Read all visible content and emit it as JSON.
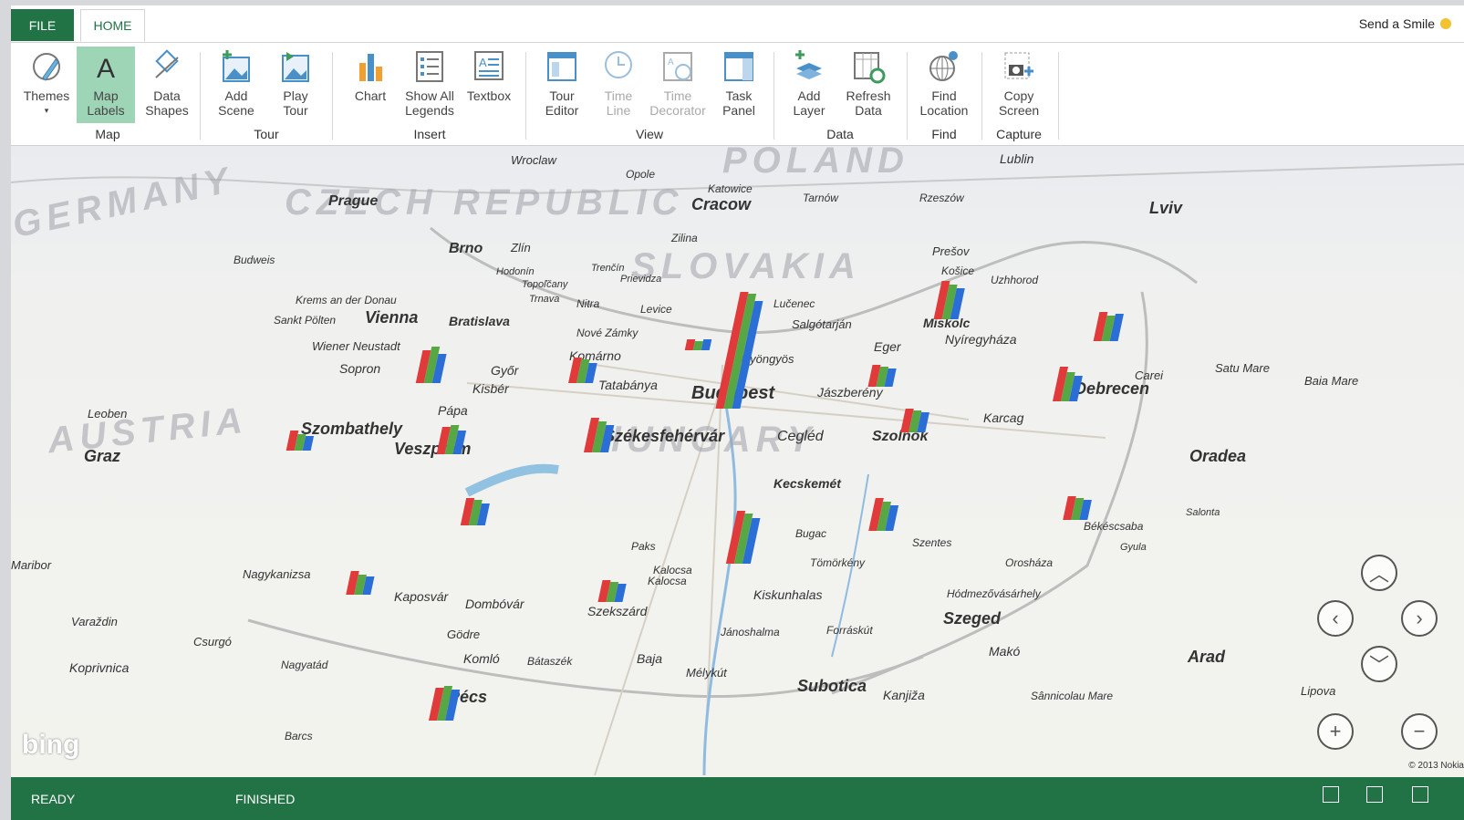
{
  "tabs": {
    "file": "FILE",
    "home": "HOME"
  },
  "send_smile": "Send a Smile",
  "ribbon": {
    "groups": {
      "map": "Map",
      "tour": "Tour",
      "insert": "Insert",
      "view": "View",
      "data": "Data",
      "find": "Find",
      "capture": "Capture"
    },
    "buttons": {
      "themes": "Themes",
      "map_labels_1": "Map",
      "map_labels_2": "Labels",
      "data_shapes_1": "Data",
      "data_shapes_2": "Shapes",
      "add_scene_1": "Add",
      "add_scene_2": "Scene",
      "play_tour_1": "Play",
      "play_tour_2": "Tour",
      "chart": "Chart",
      "show_legends_1": "Show All",
      "show_legends_2": "Legends",
      "textbox": "Textbox",
      "tour_editor_1": "Tour",
      "tour_editor_2": "Editor",
      "time_line_1": "Time",
      "time_line_2": "Line",
      "time_decorator_1": "Time",
      "time_decorator_2": "Decorator",
      "task_panel_1": "Task",
      "task_panel_2": "Panel",
      "add_layer_1": "Add",
      "add_layer_2": "Layer",
      "refresh_data_1": "Refresh",
      "refresh_data_2": "Data",
      "find_location_1": "Find",
      "find_location_2": "Location",
      "copy_screen_1": "Copy",
      "copy_screen_2": "Screen"
    }
  },
  "map": {
    "countries": [
      "CZECH REPUBLIC",
      "GERMANY",
      "POLAND",
      "SLOVAKIA",
      "HUNGARY",
      "AUSTRIA"
    ],
    "cities_big": [
      "Budapest",
      "Debrecen",
      "Szeged",
      "Vienna",
      "Cracow",
      "Subotica",
      "Arad",
      "Oradea",
      "Székesfehérvár",
      "Szombathely",
      "Veszprém",
      "Pécs",
      "Miskolc",
      "Szolnok",
      "Kecskemét",
      "Brno",
      "Bratislava",
      "Prague",
      "Graz"
    ],
    "cities_med": [
      "Győr",
      "Tatabánya",
      "Cegléd",
      "Jászberény",
      "Karcag",
      "Eger",
      "Nyíregyháza",
      "Kaposvár",
      "Dombóvár",
      "Szekszárd",
      "Kiskunhalas",
      "Baja",
      "Makó",
      "Hódmezővásárhely",
      "Kanjiža",
      "Sânnicolau Mare",
      "Pápa",
      "Sopron",
      "Kisbér",
      "Komárno",
      "Nitra",
      "Levice",
      "Nové Zámky",
      "Zlín",
      "Prešov",
      "Košice",
      "Uzhhorod",
      "Salgótarján",
      "Gyöngyös",
      "Lučenec",
      "Paks",
      "Kalocsa",
      "Bugac",
      "Tömörkény",
      "Szentes",
      "Jánoshalma",
      "Forráskút",
      "Mélykút",
      "Komló",
      "Bátaszék",
      "Nagykanizsa",
      "Koprivnica",
      "Varaždin",
      "Maribor",
      "Leoben",
      "Wiener Neustadt",
      "Sankt Pölten",
      "Krems an der Donau",
      "Budweis",
      "Wroclaw",
      "Opole",
      "Katowice",
      "Tarnów",
      "Rzeszów",
      "Lublin",
      "Lviv",
      "Zilina",
      "Trenčín",
      "Prievidza",
      "Topoľčany",
      "Trnava",
      "Hodonín",
      "Kalocsa",
      "Békéscsaba",
      "Orosháza",
      "Gyula",
      "Salonta",
      "Carei",
      "Satu Mare",
      "Baia Mare",
      "Lipova",
      "Nagyatád",
      "Barcs",
      "Csurgó",
      "Gödre"
    ],
    "bing": "bing",
    "copyright": "© 2013 Nokia"
  },
  "chart_data": {
    "type": "bar",
    "title": "",
    "series_colors": [
      "#e03a3a",
      "#57a845",
      "#2b6fd6"
    ],
    "locations": [
      "Budapest",
      "Szeged",
      "Debrecen",
      "Miskolc",
      "Szolnok",
      "Kecskemét",
      "Győr",
      "Székesfehérvár",
      "Pécs"
    ]
  },
  "statusbar": {
    "ready": "READY",
    "finished": "FINISHED"
  },
  "colors": {
    "accent": "#217346",
    "active_button": "#9fd5b7"
  }
}
